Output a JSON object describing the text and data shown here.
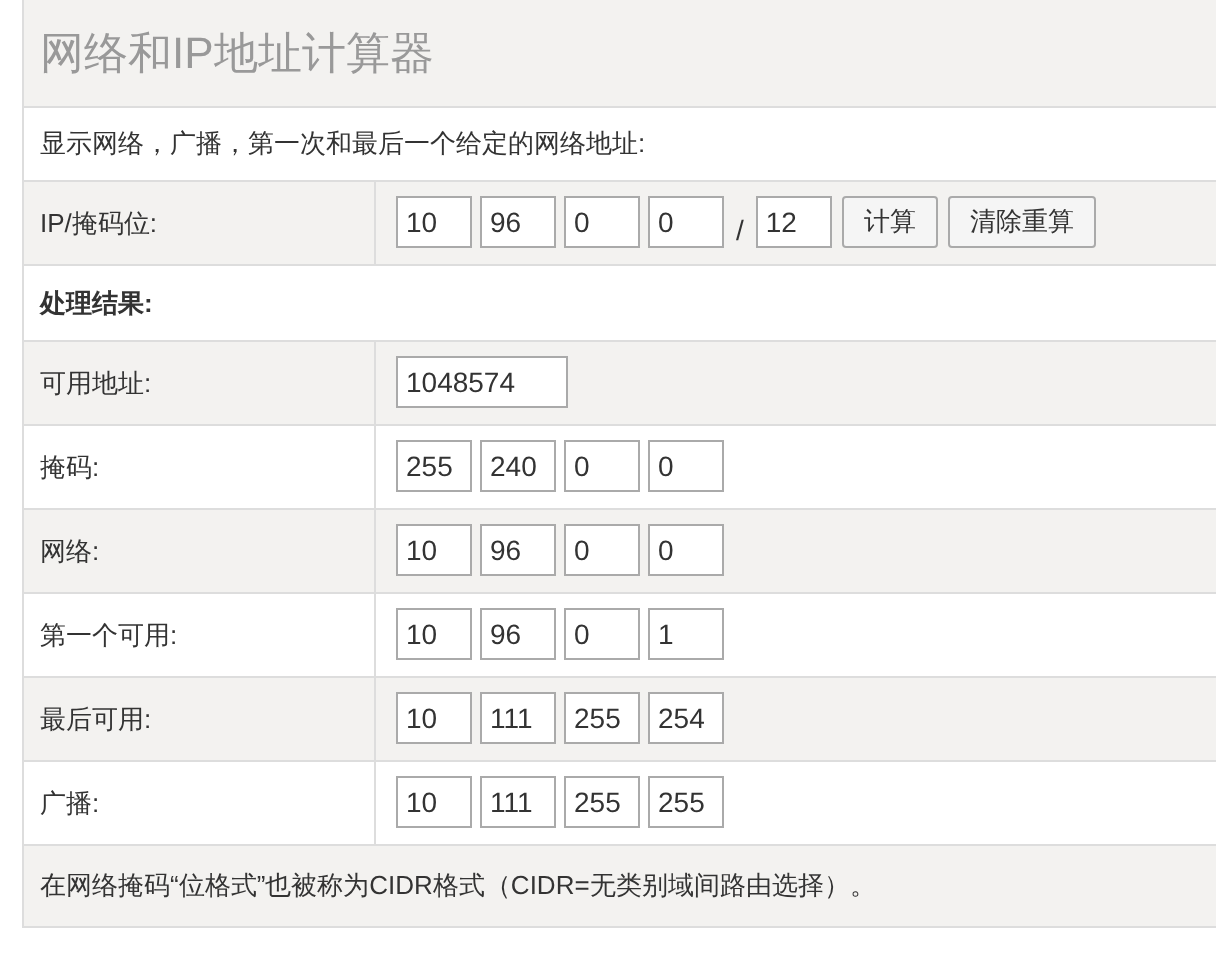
{
  "title": "网络和IP地址计算器",
  "description": "显示网络，广播，第一次和最后一个给定的网络地址:",
  "input_row": {
    "label": "IP/掩码位:",
    "octets": [
      "10",
      "96",
      "0",
      "0"
    ],
    "separator": "/",
    "mask_bits": "12",
    "buttons": [
      "计算",
      "清除重算"
    ]
  },
  "results_heading": "处理结果:",
  "results": [
    {
      "label": "可用地址:",
      "kind": "single",
      "values": [
        "1048574"
      ]
    },
    {
      "label": "掩码:",
      "kind": "octets",
      "values": [
        "255",
        "240",
        "0",
        "0"
      ]
    },
    {
      "label": "网络:",
      "kind": "octets",
      "values": [
        "10",
        "96",
        "0",
        "0"
      ]
    },
    {
      "label": "第一个可用:",
      "kind": "octets",
      "values": [
        "10",
        "96",
        "0",
        "1"
      ]
    },
    {
      "label": "最后可用:",
      "kind": "octets",
      "values": [
        "10",
        "111",
        "255",
        "254"
      ]
    },
    {
      "label": "广播:",
      "kind": "octets",
      "values": [
        "10",
        "111",
        "255",
        "255"
      ]
    }
  ],
  "footnote": "在网络掩码“位格式”也被称为CIDR格式（CIDR=无类别域间路由选择）。"
}
